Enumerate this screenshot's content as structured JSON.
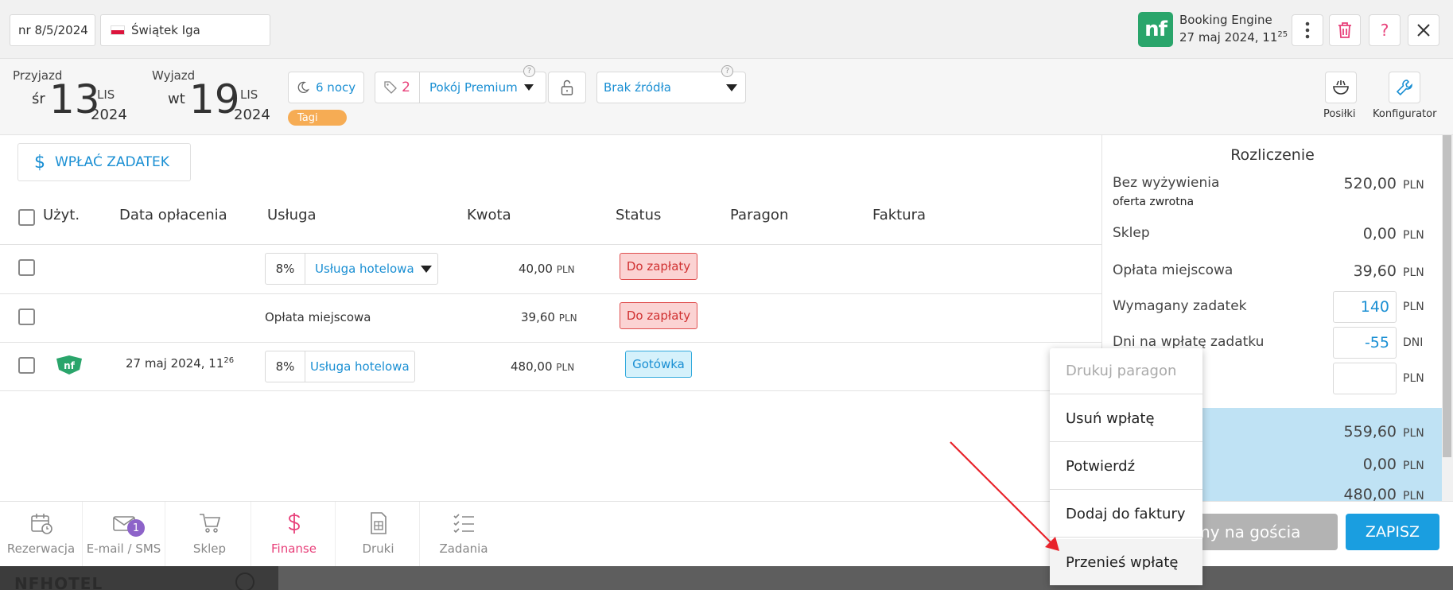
{
  "header": {
    "reservation_number": "nr 8/5/2024",
    "guest_name": "Świątek Iga",
    "source_title": "Booking Engine",
    "source_date": "27 maj 2024, 11",
    "source_time_sup": "25",
    "logo_text": "nf"
  },
  "stay": {
    "arrival_label": "Przyjazd",
    "arrival_day": "śr",
    "arrival_num": "13",
    "arrival_month": "LIS",
    "arrival_year": "2024",
    "departure_label": "Wyjazd",
    "departure_day": "wt",
    "departure_num": "19",
    "departure_month": "LIS",
    "departure_year": "2024",
    "nights": "6 nocy",
    "room_count": "2",
    "room_type": "Pokój Premium",
    "source": "Brak źródła",
    "tags_label": "Tagi",
    "meals_label": "Posiłki",
    "configurator_label": "Konfigurator"
  },
  "finance": {
    "deposit_button": "WPŁAĆ ZADATEK",
    "columns": [
      "Użyt.",
      "Data opłacenia",
      "Usługa",
      "Kwota",
      "Status",
      "Paragon",
      "Faktura"
    ],
    "rows": [
      {
        "date": "",
        "vat": "8%",
        "service": "Usługa hotelowa",
        "amount": "40,00",
        "currency": "PLN",
        "status": "Do zapłaty"
      },
      {
        "date": "",
        "vat": "",
        "service": "Opłata miejscowa",
        "amount": "39,60",
        "currency": "PLN",
        "status": "Do zapłaty"
      },
      {
        "date": "27 maj 2024, 11",
        "date_sup": "26",
        "user_logo": "nf",
        "vat": "8%",
        "service": "Usługa hotelowa",
        "amount": "480,00",
        "currency": "PLN",
        "status": "Gotówka"
      }
    ]
  },
  "settlement": {
    "title": "Rozliczenie",
    "no_meals_label": "Bez wyżywienia",
    "no_meals_sub": "oferta zwrotna",
    "no_meals_value": "520,00",
    "shop_label": "Sklep",
    "shop_value": "0,00",
    "local_fee_label": "Opłata miejscowa",
    "local_fee_value": "39,60",
    "deposit_label": "Wymagany zadatek",
    "deposit_value": "140",
    "deposit_days_label": "Dni na wpłatę zadatku",
    "deposit_days_value": "-55",
    "days_unit": "DNI",
    "currency": "PLN",
    "summary_values": [
      "559,60",
      "0,00",
      "480,00"
    ]
  },
  "nav": [
    {
      "label": "Rezerwacja"
    },
    {
      "label": "E-mail / SMS",
      "badge": "1"
    },
    {
      "label": "Sklep"
    },
    {
      "label": "Finanse"
    },
    {
      "label": "Druki"
    },
    {
      "label": "Zadania"
    }
  ],
  "actions": {
    "gray_button": "Czekamy na gościa",
    "save_button": "ZAPISZ"
  },
  "context_menu": {
    "items": [
      "Drukuj paragon",
      "Usuń wpłatę",
      "Potwierdź",
      "Dodaj do faktury",
      "Przenieś wpłatę"
    ]
  },
  "background": {
    "hotel_text": "NFHOTEL"
  },
  "colors": {
    "accent_blue": "#1a8fd3",
    "finance_pink": "#e8407a",
    "due_red": "#d03030",
    "tag_orange": "#f6ac54",
    "logo_green": "#2aa56b"
  }
}
